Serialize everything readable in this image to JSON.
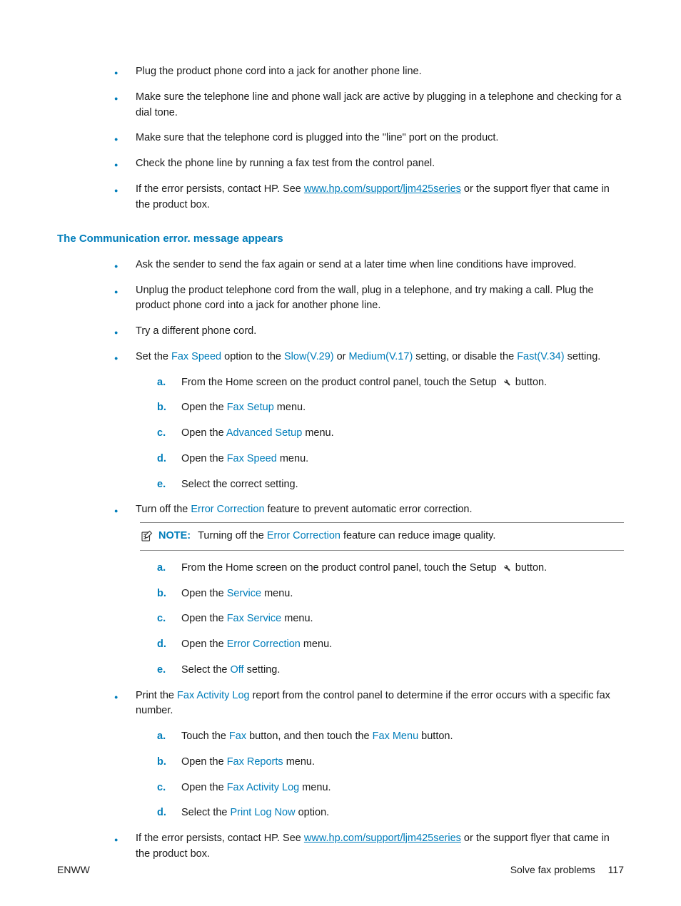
{
  "topBullets": [
    {
      "text": "Plug the product phone cord into a jack for another phone line."
    },
    {
      "text": "Make sure the telephone line and phone wall jack are active by plugging in a telephone and checking for a dial tone."
    },
    {
      "text": "Make sure that the telephone cord is plugged into the \"line\" port on the product."
    },
    {
      "text": "Check the phone line by running a fax test from the control panel."
    },
    {
      "pre": "If the error persists, contact HP. See ",
      "link": "www.hp.com/support/ljm425series",
      "post": " or the support flyer that came in the product box."
    }
  ],
  "sectionTitle": "The Communication error. message appears",
  "commBullets": {
    "b1": "Ask the sender to send the fax again or send at a later time when line conditions have improved.",
    "b2": "Unplug the product telephone cord from the wall, plug in a telephone, and try making a call. Plug the product phone cord into a jack for another phone line.",
    "b3": "Try a different phone cord.",
    "b4": {
      "pre": "Set the ",
      "t1": "Fax Speed",
      "mid1": " option to the ",
      "t2": "Slow(V.29)",
      "mid2": " or ",
      "t3": "Medium(V.17)",
      "mid3": " setting, or disable the ",
      "t4": "Fast(V.34)",
      "post": " setting."
    },
    "b4steps": {
      "a": {
        "pre": "From the Home screen on the product control panel, touch the Setup ",
        "post": " button."
      },
      "b": {
        "pre": "Open the ",
        "term": "Fax Setup",
        "post": " menu."
      },
      "c": {
        "pre": "Open the ",
        "term": "Advanced Setup",
        "post": " menu."
      },
      "d": {
        "pre": "Open the ",
        "term": "Fax Speed",
        "post": " menu."
      },
      "e": "Select the correct setting."
    },
    "b5": {
      "pre": "Turn off the ",
      "term": "Error Correction",
      "post": " feature to prevent automatic error correction."
    },
    "note": {
      "label": "NOTE:",
      "pre": "Turning off the ",
      "term": "Error Correction",
      "post": " feature can reduce image quality."
    },
    "b5steps": {
      "a": {
        "pre": "From the Home screen on the product control panel, touch the Setup ",
        "post": " button."
      },
      "b": {
        "pre": "Open the ",
        "term": "Service",
        "post": " menu."
      },
      "c": {
        "pre": "Open the ",
        "term": "Fax Service",
        "post": " menu."
      },
      "d": {
        "pre": "Open the ",
        "term": "Error Correction",
        "post": " menu."
      },
      "e": {
        "pre": "Select the ",
        "term": "Off",
        "post": " setting."
      }
    },
    "b6": {
      "pre": "Print the ",
      "term": "Fax Activity Log",
      "post": " report from the control panel to determine if the error occurs with a specific fax number."
    },
    "b6steps": {
      "a": {
        "pre": "Touch the ",
        "t1": "Fax",
        "mid": " button, and then touch the ",
        "t2": "Fax Menu",
        "post": " button."
      },
      "b": {
        "pre": "Open the ",
        "term": "Fax Reports",
        "post": " menu."
      },
      "c": {
        "pre": "Open the ",
        "term": "Fax Activity Log",
        "post": " menu."
      },
      "d": {
        "pre": "Select the ",
        "term": "Print Log Now",
        "post": " option."
      }
    },
    "b7": {
      "pre": "If the error persists, contact HP. See ",
      "link": "www.hp.com/support/ljm425series",
      "post": " or the support flyer that came in the product box."
    }
  },
  "footer": {
    "left": "ENWW",
    "rightLabel": "Solve fax problems",
    "page": "117"
  }
}
